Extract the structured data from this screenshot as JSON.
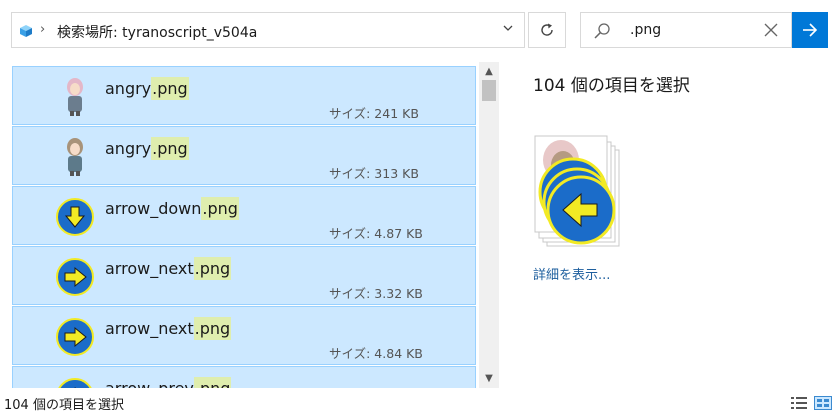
{
  "address_bar": {
    "path_text": "検索場所: tyranoscript_v504a",
    "folder_icon": "folder-cube-icon",
    "chevron_icon": "chevron-right-icon",
    "dropdown_icon": "chevron-down-icon"
  },
  "refresh": {
    "icon": "refresh-icon"
  },
  "search": {
    "value": ".png",
    "icon": "search-icon",
    "clear_icon": "close-icon",
    "go_icon": "arrow-right-icon"
  },
  "files": [
    {
      "name_base": "angry",
      "name_match": ".png",
      "size": "サイズ: 241 KB",
      "icon": "character-girl-thumbnail"
    },
    {
      "name_base": "angry",
      "name_match": ".png",
      "size": "サイズ: 313 KB",
      "icon": "character-boy-thumbnail"
    },
    {
      "name_base": "arrow_down",
      "name_match": ".png",
      "size": "サイズ: 4.87 KB",
      "icon": "arrow-down-thumbnail"
    },
    {
      "name_base": "arrow_next",
      "name_match": ".png",
      "size": "サイズ: 3.32 KB",
      "icon": "arrow-next-thumbnail"
    },
    {
      "name_base": "arrow_next",
      "name_match": ".png",
      "size": "サイズ: 4.84 KB",
      "icon": "arrow-next-thumbnail"
    },
    {
      "name_base": "arrow_prev",
      "name_match": ".png",
      "size": "",
      "icon": "arrow-prev-thumbnail"
    }
  ],
  "details": {
    "selection_count": "104 個の項目を選択",
    "show_more": "詳細を表示..."
  },
  "status_bar": {
    "text": "104 個の項目を選択",
    "details_view_icon": "details-view-icon",
    "large_icons_view_icon": "large-icons-view-icon"
  },
  "colors": {
    "selection_bg": "#cce8ff",
    "selection_border": "#99d1ff",
    "highlight": "#dfeeae",
    "accent": "#0078d7",
    "link": "#1e5f9e"
  }
}
